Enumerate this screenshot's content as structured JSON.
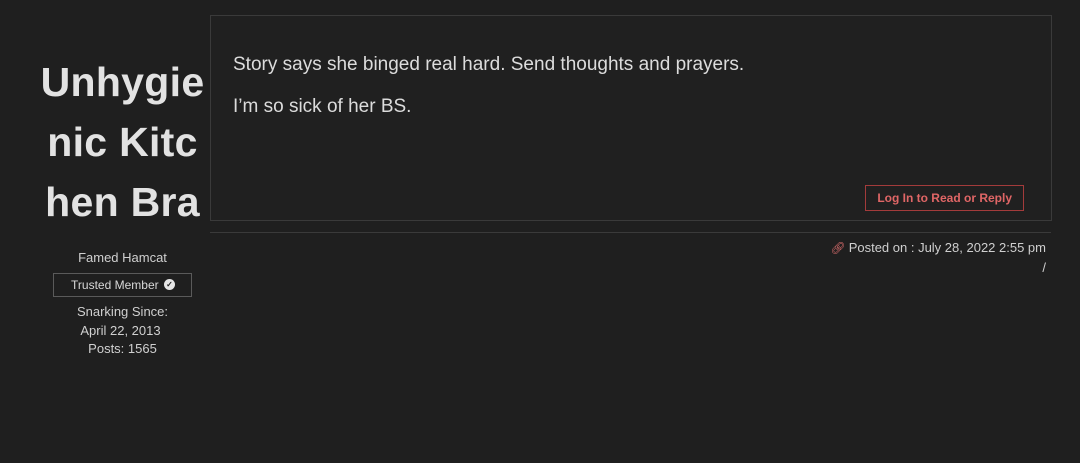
{
  "author": {
    "name": "Unhygienic Kitchen Bra",
    "rank": "Famed Hamcat",
    "badge": "Trusted Member",
    "since_label": "Snarking Since:",
    "since_date": "April 22, 2013",
    "posts": "Posts: 1565"
  },
  "post": {
    "paragraphs": [
      "Story says she binged real hard. Send thoughts and prayers.",
      "I’m so sick of her BS."
    ],
    "login_button": "Log In to Read or Reply"
  },
  "meta": {
    "posted_on": "Posted on : July 28, 2022 2:55 pm",
    "separator": "/",
    "link_icon": "link-icon"
  },
  "colors": {
    "background": "#1f1f1f",
    "accent": "#d26a6a",
    "border": "#3a3a3a"
  }
}
